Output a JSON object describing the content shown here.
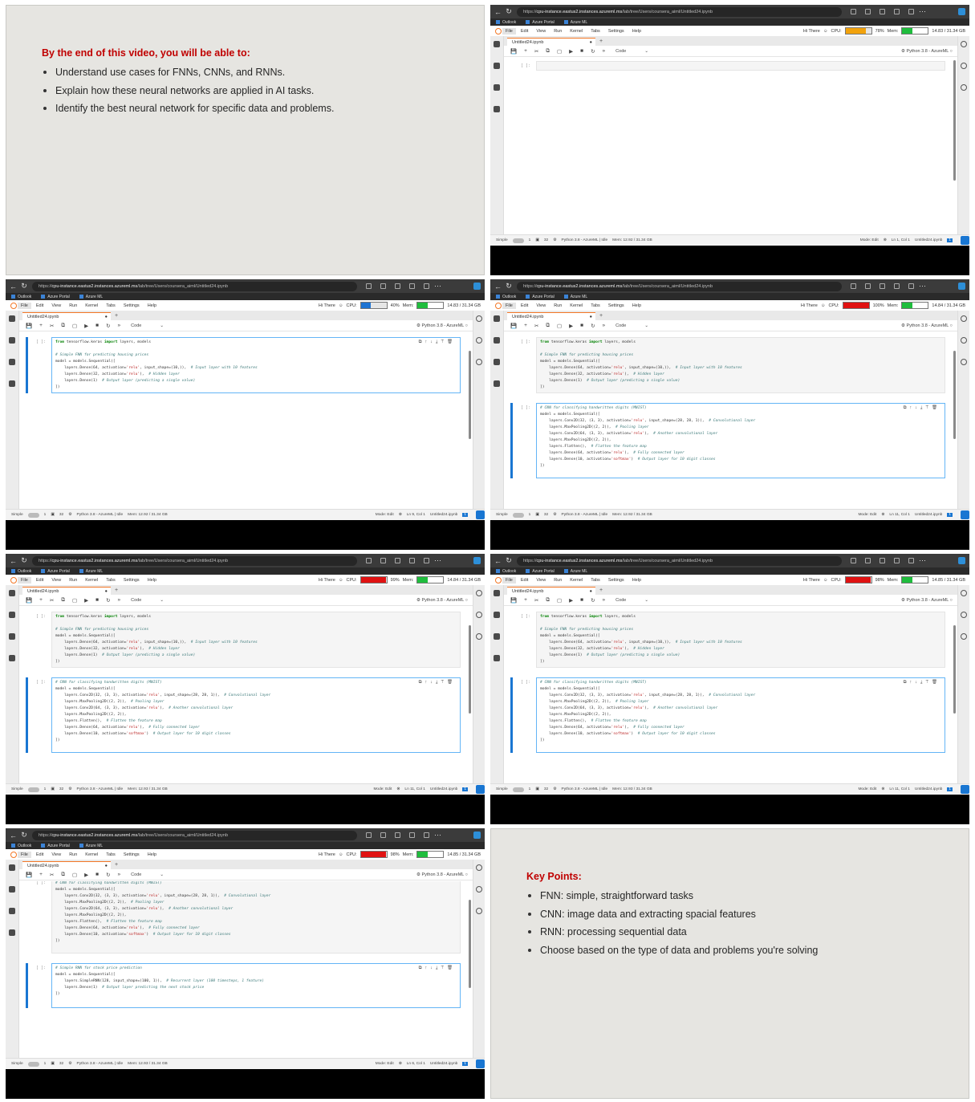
{
  "slides": {
    "intro": {
      "heading": "By the end of this video, you will be able to:",
      "bullets": [
        "Understand use cases for FNNs, CNNs, and RNNs.",
        "Explain how these neural networks are applied in AI tasks.",
        "Identify the best neural network for specific data and problems."
      ]
    },
    "keypoints": {
      "heading": "Key Points:",
      "bullets": [
        "FNN: simple, straightforward tasks",
        "CNN: image data and extracting spacial features",
        "RNN: processing sequential data",
        "Choose based on the type of data and problems you're solving"
      ]
    }
  },
  "browser": {
    "url_scheme": "https://",
    "url_host": "cpu-instance.eastus2.instances.azureml.ms",
    "url_path": "/lab/tree/Users/coursera_aiml/Untitled24.ipynb",
    "favorites": [
      "Outlook",
      "Azure Portal",
      "Azure ML"
    ]
  },
  "jupyter": {
    "menu": [
      "File",
      "Edit",
      "View",
      "Run",
      "Kernel",
      "Tabs",
      "Settings",
      "Help"
    ],
    "user": "Hi There",
    "cpu_label": "CPU:",
    "mem_label": "Mem:",
    "tab_name": "Untitled24.ipynb",
    "tab_dot": "●",
    "tab_plus": "+",
    "cell_type": "Code",
    "kernel": "Python 3.8 - AzureML",
    "prompt": "[ ]:",
    "status_simple": "Simple",
    "status_count": "1",
    "status_32": "32",
    "status_filename": "Untitled24.ipynb"
  },
  "colors": {
    "accent_red": "#c00000",
    "cpu_orange": "#f2a20c",
    "cpu_blue": "#1e73d2",
    "cpu_red": "#e01212",
    "mem_green": "#1fbd3d"
  },
  "shots": [
    {
      "cpu_pct": "78%",
      "cpu_fill": 0.78,
      "cpu_color": "#f2a20c",
      "mem_text": "14.83 / 31.34 GB",
      "status_kernel": "Python 3.8 - AzureML | Idle",
      "status_mem": "Mem: 12.92 / 31.34 GB",
      "mode": "Mode: Edit",
      "pos": "Ln 1, Col 1"
    },
    {
      "cpu_pct": "40%",
      "cpu_fill": 0.4,
      "cpu_color": "#1e73d2",
      "mem_text": "14.83 / 31.34 GB",
      "status_kernel": "Python 3.8 - AzureML | Idle",
      "status_mem": "Mem: 12.92 / 31.34 GB",
      "mode": "Mode: Edit",
      "pos": "Ln 9, Col 1"
    },
    {
      "cpu_pct": "100%",
      "cpu_fill": 1.0,
      "cpu_color": "#e01212",
      "mem_text": "14.84 / 31.34 GB",
      "status_kernel": "Python 3.8 - AzureML | Idle",
      "status_mem": "Mem: 12.92 / 31.34 GB",
      "mode": "Mode: Edit",
      "pos": "Ln 11, Col 1"
    },
    {
      "cpu_pct": "99%",
      "cpu_fill": 0.99,
      "cpu_color": "#e01212",
      "mem_text": "14.84 / 31.34 GB",
      "status_kernel": "Python 3.8 - AzureML | Idle",
      "status_mem": "Mem: 12.93 / 31.34 GB",
      "mode": "Mode: Edit",
      "pos": "Ln 11, Col 1"
    },
    {
      "cpu_pct": "98%",
      "cpu_fill": 0.98,
      "cpu_color": "#e01212",
      "mem_text": "14.85 / 31.34 GB",
      "status_kernel": "Python 3.8 - AzureML | Idle",
      "status_mem": "Mem: 12.93 / 31.34 GB",
      "mode": "Mode: Edit",
      "pos": "Ln 11, Col 1"
    },
    {
      "cpu_pct": "98%",
      "cpu_fill": 0.98,
      "cpu_color": "#e01212",
      "mem_text": "14.85 / 31.34 GB",
      "status_kernel": "Python 3.8 - AzureML | Idle",
      "status_mem": "Mem: 12.93 / 31.34 GB",
      "mode": "Mode: Edit",
      "pos": "Ln 6, Col 1"
    }
  ],
  "code": {
    "fnn": "from tensorflow.keras import layers, models\n\n# Simple FNN for predicting housing prices\nmodel = models.Sequential([\n    layers.Dense(64, activation='relu', input_shape=(10,)),  # Input layer with 10 features\n    layers.Dense(32, activation='relu'),  # Hidden layer\n    layers.Dense(1)  # Output layer (predicting a single value)\n])",
    "cnn": "# CNN for classifying handwritten digits (MNIST)\nmodel = models.Sequential([\n    layers.Conv2D(32, (3, 3), activation='relu', input_shape=(28, 28, 1)),  # Convolutional layer\n    layers.MaxPooling2D((2, 2)),  # Pooling layer\n    layers.Conv2D(64, (3, 3), activation='relu'),  # Another convolutional layer\n    layers.MaxPooling2D((2, 2)),\n    layers.Flatten(),  # Flatten the feature map\n    layers.Dense(64, activation='relu'),  # Fully connected layer\n    layers.Dense(10, activation='softmax')  # Output layer for 10 digit classes\n])",
    "rnn": "# Simple RNN for stock price prediction\nmodel = models.Sequential([\n    layers.SimpleRNN(128, input_shape=(100, 1)),  # Recurrent layer (100 timesteps, 1 feature)\n    layers.Dense(1)  # Output layer predicting the next stock price\n])"
  }
}
